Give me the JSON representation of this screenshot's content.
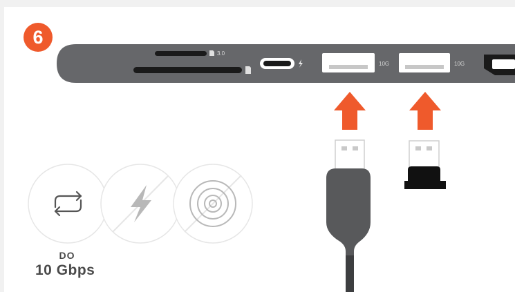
{
  "step": {
    "number": "6"
  },
  "hub": {
    "sd_label": "3.0",
    "usb_a_1_label": "10G",
    "usb_a_2_label": "10G"
  },
  "icons": {
    "sync": "sync-arrows-icon",
    "charging": "charging-bolt-crossed-icon",
    "disc": "disc-crossed-icon"
  },
  "caption": {
    "line1": "DO",
    "line2": "10 Gbps"
  },
  "colors": {
    "accent": "#ef5a2c",
    "hub": "#66676a",
    "port": "#1a1a1a",
    "cable": "#58595b",
    "icon_gray": "#b8b8b8"
  }
}
